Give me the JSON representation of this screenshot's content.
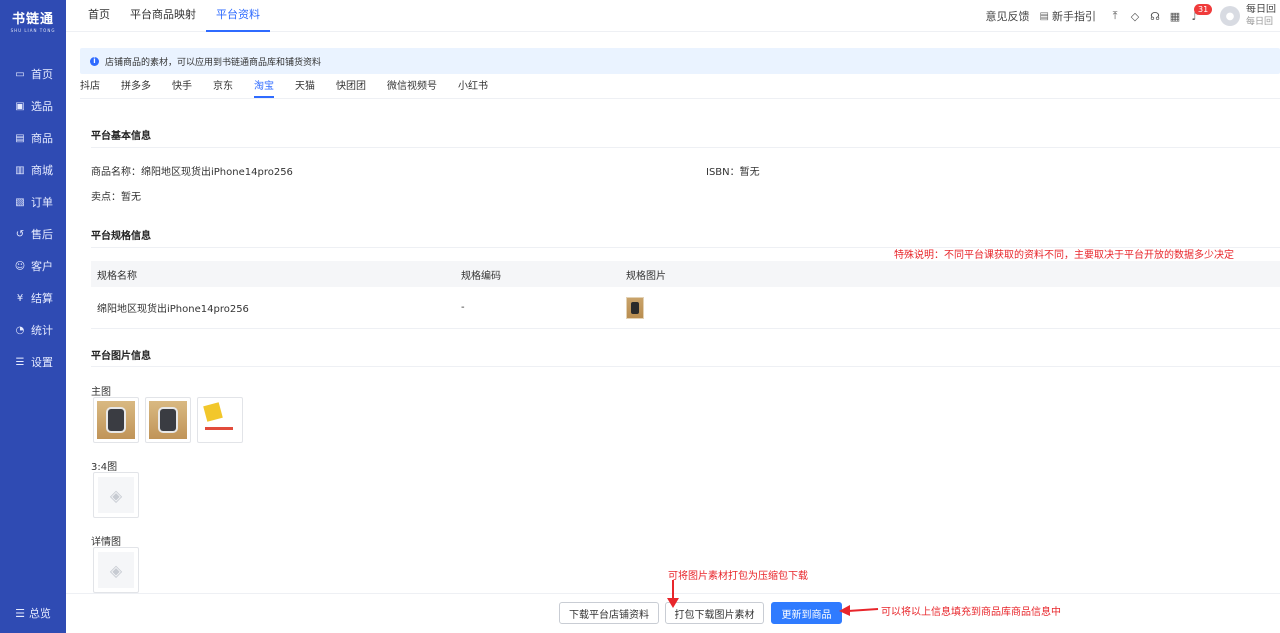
{
  "sidebar": {
    "logo_cn": "书链通",
    "logo_en": "SHU LIAN TONG",
    "items": [
      {
        "label": "首页",
        "icon": "monitor-icon"
      },
      {
        "label": "选品",
        "icon": "select-icon"
      },
      {
        "label": "商品",
        "icon": "product-icon"
      },
      {
        "label": "商城",
        "icon": "shop-icon"
      },
      {
        "label": "订单",
        "icon": "order-icon"
      },
      {
        "label": "售后",
        "icon": "aftersale-icon"
      },
      {
        "label": "客户",
        "icon": "customer-icon"
      },
      {
        "label": "结算",
        "icon": "settlement-icon"
      },
      {
        "label": "统计",
        "icon": "stats-icon"
      },
      {
        "label": "设置",
        "icon": "settings-icon"
      }
    ],
    "bottom_label": "总览"
  },
  "header": {
    "tabs": [
      "首页",
      "平台商品映射",
      "平台资料"
    ],
    "feedback": "意见反馈",
    "guide": "新手指引",
    "badge_count": "31",
    "user_name": "每日回",
    "user_sub": "每日回"
  },
  "notice": "店铺商品的素材，可以应用到书链通商品库和铺货资料",
  "platform_tabs": [
    "抖店",
    "拼多多",
    "快手",
    "京东",
    "淘宝",
    "天猫",
    "快团团",
    "微信视频号",
    "小红书"
  ],
  "basic": {
    "title": "平台基本信息",
    "name_label": "商品名称：",
    "name_value": "绵阳地区现货出iPhone14pro256",
    "isbn_label": "ISBN：",
    "isbn_value": "暂无",
    "selling_label": "卖点：",
    "selling_value": "暂无"
  },
  "spec": {
    "title": "平台规格信息",
    "headers": [
      "规格名称",
      "规格编码",
      "规格图片"
    ],
    "rows": [
      {
        "name": "绵阳地区现货出iPhone14pro256",
        "code": "-"
      }
    ]
  },
  "images": {
    "title": "平台图片信息",
    "main_label": "主图",
    "ratio_label": "3:4图",
    "detail_label": "详情图"
  },
  "annotations": {
    "special_note": "特殊说明：不同平台课获取的资料不同，主要取决于平台开放的数据多少决定",
    "pack_note": "可将图片素材打包为压缩包下载",
    "update_note": "可以将以上信息填充到商品库商品信息中"
  },
  "footer": {
    "download_label": "下载平台店铺资料",
    "pack_label": "打包下载图片素材",
    "update_label": "更新到商品"
  },
  "colors": {
    "sidebar": "#2f4bb3",
    "accent": "#2f6bff",
    "annotation": "#e8262b"
  }
}
